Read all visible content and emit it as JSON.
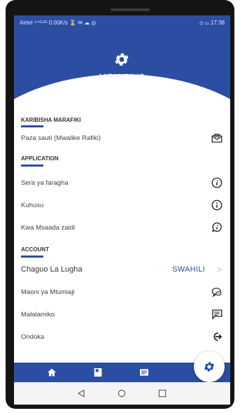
{
  "status": {
    "left": "Airtel ⁴⁺ᴳ⁴ᴳ 0.00K/s ⌛ ✉ ☁ ◎",
    "right": "⦸ ▭ 17:38"
  },
  "header": {
    "title": "MIPANGILIO",
    "icon": "gear-icon"
  },
  "sections": {
    "karibisha": {
      "title": "KARIBISHA MARAFIKI",
      "items": [
        {
          "label": "Paza sauti (Mwalike Rafiki)",
          "icon": "invite-envelope-icon"
        }
      ]
    },
    "application": {
      "title": "APPLICATION",
      "items": [
        {
          "label": "Sera ya faragha",
          "icon": "info-italic-icon"
        },
        {
          "label": "Kuhusu",
          "icon": "info-icon"
        },
        {
          "label": "Kwa Msaada zaidi",
          "icon": "help-bubble-icon"
        }
      ]
    },
    "account": {
      "title": "ACCOUNT",
      "language": {
        "label": "Chaguo La Lugha",
        "value": "SWAHILI",
        "icon": "chevron-right-icon"
      },
      "items": [
        {
          "label": "Maoni ya Mtumiaji",
          "icon": "feedback-bubble-icon"
        },
        {
          "label": "Malalamiko",
          "icon": "complaint-message-icon"
        },
        {
          "label": "Ondoka",
          "icon": "logout-icon"
        }
      ]
    }
  },
  "bottom_nav": [
    "home-icon",
    "book-icon",
    "card-icon",
    "settings-gear-icon"
  ],
  "android_nav": [
    "back-triangle-icon",
    "home-circle-icon",
    "recents-square-icon"
  ],
  "colors": {
    "primary": "#2c4ea2",
    "background": "#ffffff",
    "text": "#444444"
  }
}
